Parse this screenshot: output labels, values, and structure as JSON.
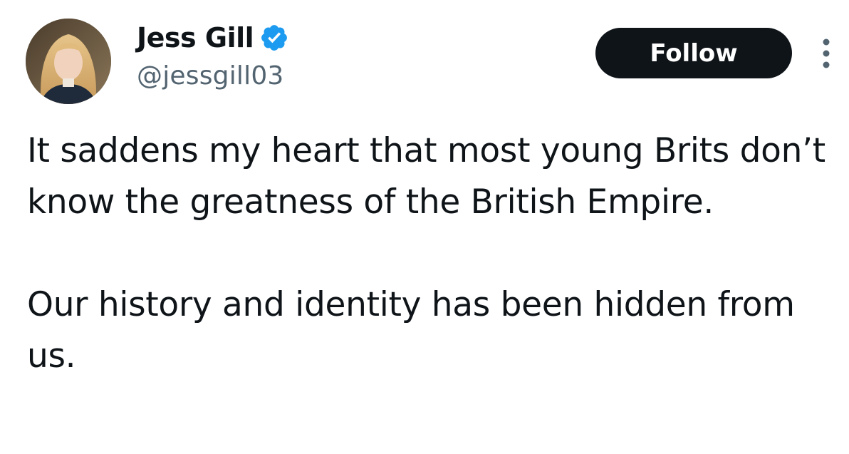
{
  "author": {
    "display_name": "Jess Gill",
    "handle": "@jessgill03",
    "verified": true
  },
  "actions": {
    "follow_label": "Follow"
  },
  "icons": {
    "verified": "verified-badge-icon",
    "more": "more-options-icon"
  },
  "colors": {
    "verified_blue": "#1d9bf0",
    "text": "#0f1419",
    "secondary_text": "#536471",
    "button_bg": "#0f1419"
  },
  "tweet": {
    "paragraphs": [
      "It saddens my heart that most young Brits don’t know the greatness of the British Empire.",
      "Our history and identity has been hidden from us."
    ]
  }
}
